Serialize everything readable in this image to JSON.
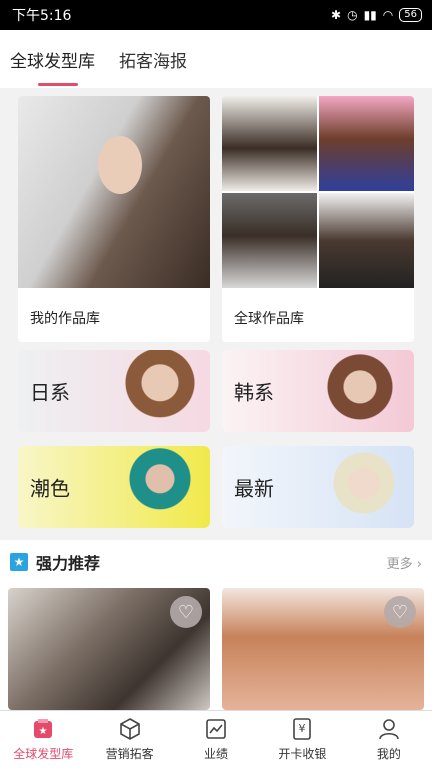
{
  "status_bar": {
    "time": "下午5:16",
    "battery": "56"
  },
  "tabs": [
    {
      "label": "全球发型库"
    },
    {
      "label": "拓客海报"
    }
  ],
  "gallery": {
    "my_works": "我的作品库",
    "global_works": "全球作品库"
  },
  "categories": [
    {
      "label": "日系",
      "bg": "#eef0f2"
    },
    {
      "label": "韩系",
      "bg": "#fbe9ee"
    },
    {
      "label": "潮色",
      "bg": "#f6f4b0"
    },
    {
      "label": "最新",
      "bg": "#e6eef8"
    }
  ],
  "recommend": {
    "title": "强力推荐",
    "more": "更多"
  },
  "bottom_nav": [
    {
      "label": "全球发型库",
      "icon": "hair-library-icon"
    },
    {
      "label": "营销拓客",
      "icon": "box-icon"
    },
    {
      "label": "业绩",
      "icon": "chart-icon"
    },
    {
      "label": "开卡收银",
      "icon": "cashier-icon"
    },
    {
      "label": "我的",
      "icon": "user-icon"
    }
  ],
  "colors": {
    "accent": "#e44b6b",
    "recommend_icon": "#2aa3e0"
  }
}
